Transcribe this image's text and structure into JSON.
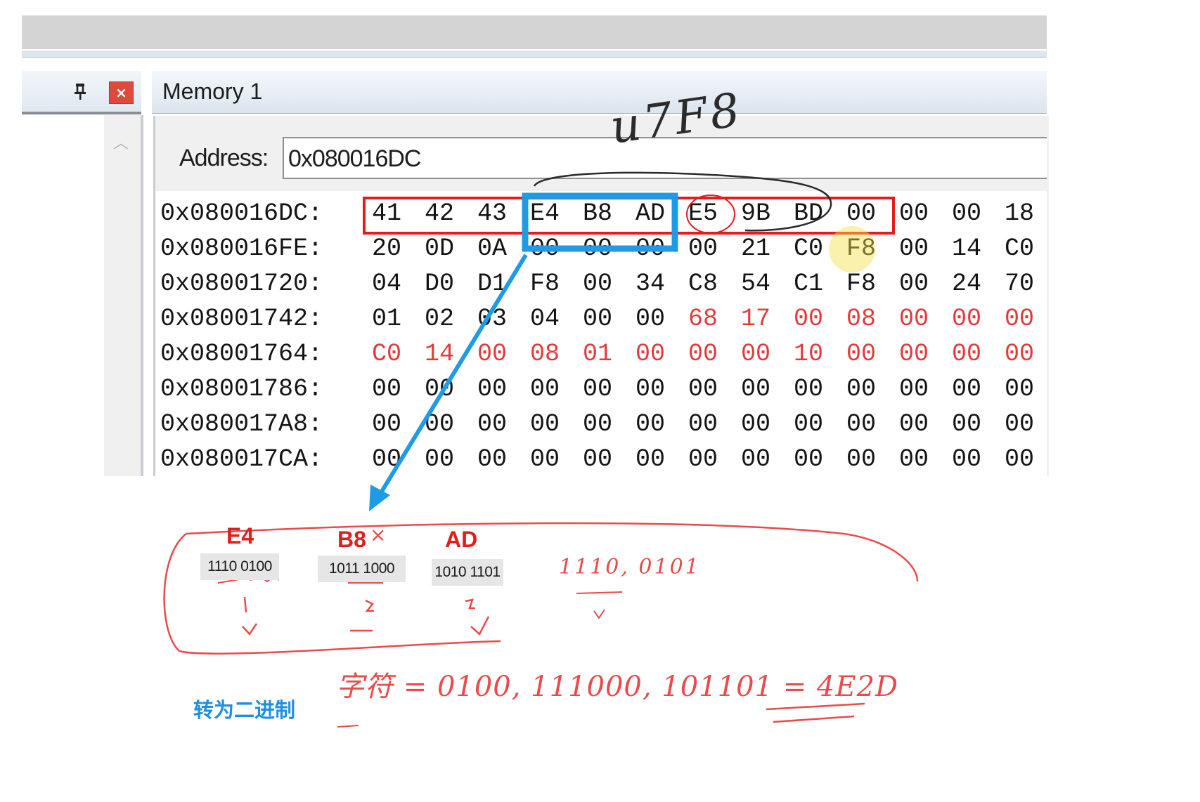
{
  "left_pane": {
    "pin_icon": "pin-icon",
    "close_label": "×",
    "scroll_up_glyph": "︿"
  },
  "memory_window": {
    "title": "Memory 1",
    "address_label": "Address:",
    "address_value": "0x080016DC",
    "rows": [
      {
        "addr": "0x080016DC:",
        "bytes": [
          "41",
          "42",
          "43",
          "E4",
          "B8",
          "AD",
          "E5",
          "9B",
          "BD",
          "00",
          "00",
          "00",
          "18"
        ],
        "red_from": 99
      },
      {
        "addr": "0x080016FE:",
        "bytes": [
          "20",
          "0D",
          "0A",
          "00",
          "00",
          "00",
          "00",
          "21",
          "C0",
          "F8",
          "00",
          "14",
          "C0"
        ],
        "red_from": 99
      },
      {
        "addr": "0x08001720:",
        "bytes": [
          "04",
          "D0",
          "D1",
          "F8",
          "00",
          "34",
          "C8",
          "54",
          "C1",
          "F8",
          "00",
          "24",
          "70"
        ],
        "red_from": 99
      },
      {
        "addr": "0x08001742:",
        "bytes": [
          "01",
          "02",
          "03",
          "04",
          "00",
          "00",
          "68",
          "17",
          "00",
          "08",
          "00",
          "00",
          "00"
        ],
        "red_from": 6
      },
      {
        "addr": "0x08001764:",
        "bytes": [
          "C0",
          "14",
          "00",
          "08",
          "01",
          "00",
          "00",
          "00",
          "10",
          "00",
          "00",
          "00",
          "00"
        ],
        "red_from": 0
      },
      {
        "addr": "0x08001786:",
        "bytes": [
          "00",
          "00",
          "00",
          "00",
          "00",
          "00",
          "00",
          "00",
          "00",
          "00",
          "00",
          "00",
          "00"
        ],
        "red_from": 99
      },
      {
        "addr": "0x080017A8:",
        "bytes": [
          "00",
          "00",
          "00",
          "00",
          "00",
          "00",
          "00",
          "00",
          "00",
          "00",
          "00",
          "00",
          "00"
        ],
        "red_from": 99
      },
      {
        "addr": "0x080017CA:",
        "bytes": [
          "00",
          "00",
          "00",
          "00",
          "00",
          "00",
          "00",
          "00",
          "00",
          "00",
          "00",
          "00",
          "00"
        ],
        "red_from": 99
      }
    ],
    "byte_color": "#141414",
    "changed_byte_color": "#e03b3b"
  },
  "annotations": {
    "colors": {
      "red": "#e21d1d",
      "blue": "#1f8fe0",
      "ink": "#2b2b2b"
    },
    "handwritten_top": "u7F8",
    "bytes": [
      {
        "label": "E4",
        "binary": "1110 0100"
      },
      {
        "label": "B8",
        "binary": "1011 1000",
        "mark": "×"
      },
      {
        "label": "AD",
        "binary": "1010 1101"
      }
    ],
    "handwritten_bits": "1110, 0101",
    "handwritten_result": "字符 = 0100, 111000, 101101 = 4E2D",
    "caption": "转为二进制"
  }
}
